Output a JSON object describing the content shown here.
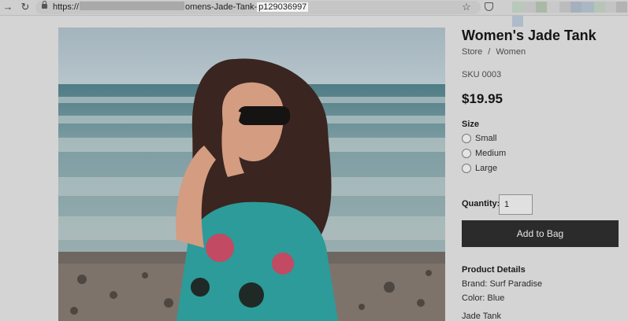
{
  "browser": {
    "url_prefix": "https://",
    "url_visible": "omens-Jade-Tank-",
    "url_highlight": "p129036997",
    "back_icon": "arrow-right-icon",
    "reload_icon": "reload-icon",
    "bookmark_icon": "star-icon",
    "extension_icon": "pocket-icon"
  },
  "product": {
    "title": "Women's Jade Tank",
    "breadcrumb": {
      "store": "Store",
      "separator": "/",
      "category": "Women"
    },
    "sku": "SKU 0003",
    "price": "$19.95",
    "size": {
      "label": "Size",
      "options": [
        "Small",
        "Medium",
        "Large"
      ]
    },
    "quantity": {
      "label": "Quantity:",
      "value": "1"
    },
    "add_to_bag": "Add to Bag",
    "details": {
      "heading": "Product Details",
      "brand": "Brand: Surf Paradise",
      "color": "Color: Blue",
      "name": "Jade Tank"
    }
  },
  "colors": {
    "page_background": "#d4d4d4",
    "button_background": "#2b2b2b",
    "button_text": "#e6e6e6"
  }
}
